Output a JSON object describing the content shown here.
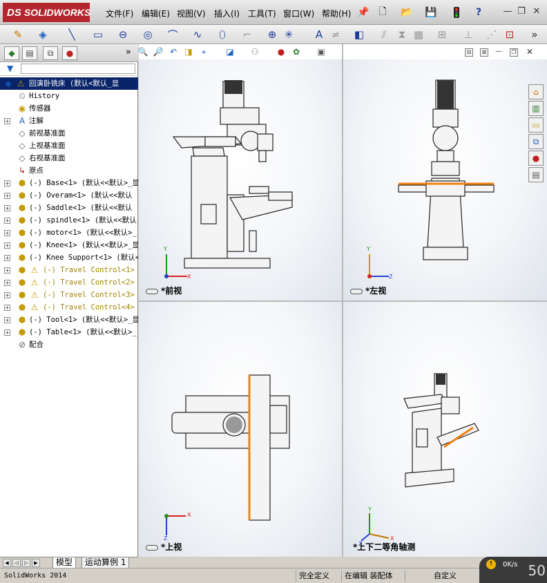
{
  "app": {
    "logo_text": "SOLIDWORKS",
    "logo_ds": "DS"
  },
  "menu": [
    "文件(F)",
    "编辑(E)",
    "视图(V)",
    "插入(I)",
    "工具(T)",
    "窗口(W)",
    "帮助(H)"
  ],
  "tabs": [
    "特征管理器",
    "属性管理器",
    "配置管理器",
    "外观管理器"
  ],
  "tree": {
    "root": "回演卧铣床 (默认<默认_显",
    "items": [
      {
        "label": "History",
        "icon": "history-icon",
        "indent": 1
      },
      {
        "label": "传感器",
        "icon": "sensor-icon",
        "indent": 1
      },
      {
        "label": "注解",
        "icon": "annotation-icon",
        "indent": 1,
        "expand": true
      },
      {
        "label": "前视基准面",
        "icon": "plane-icon",
        "indent": 1
      },
      {
        "label": "上视基准面",
        "icon": "plane-icon",
        "indent": 1
      },
      {
        "label": "右视基准面",
        "icon": "plane-icon",
        "indent": 1
      },
      {
        "label": "原点",
        "icon": "origin-icon",
        "indent": 1
      },
      {
        "label": "(-) Base<1> (默认<<默认>_显",
        "icon": "part-icon",
        "indent": 1,
        "expand": true
      },
      {
        "label": "(-) Overam<1> (默认<<默认",
        "icon": "part-icon",
        "indent": 1,
        "expand": true
      },
      {
        "label": "(-) Saddle<1> (默认<<默认",
        "icon": "part-icon",
        "indent": 1,
        "expand": true
      },
      {
        "label": "(-) spindle<1> (默认<<默认",
        "icon": "part-icon",
        "indent": 1,
        "expand": true
      },
      {
        "label": "(-) motor<1> (默认<<默认>_",
        "icon": "part-icon",
        "indent": 1,
        "expand": true
      },
      {
        "label": "(-) Knee<1> (默认<<默认>_显",
        "icon": "part-icon",
        "indent": 1,
        "expand": true
      },
      {
        "label": "(-) Knee Support<1> (默认<",
        "icon": "part-icon",
        "indent": 1,
        "expand": true
      },
      {
        "label": "(-) Travel Control<1> (",
        "icon": "part-icon",
        "indent": 1,
        "expand": true,
        "warn": true
      },
      {
        "label": "(-) Travel Control<2> (",
        "icon": "part-icon",
        "indent": 1,
        "expand": true,
        "warn": true
      },
      {
        "label": "(-) Travel Control<3> (",
        "icon": "part-icon",
        "indent": 1,
        "expand": true,
        "warn": true
      },
      {
        "label": "(-) Travel Control<4> (",
        "icon": "part-icon",
        "indent": 1,
        "expand": true,
        "warn": true
      },
      {
        "label": "(-) Tool<1> (默认<<默认>_显",
        "icon": "part-icon",
        "indent": 1,
        "expand": true
      },
      {
        "label": "(-) Table<1> (默认<<默认>_",
        "icon": "part-icon",
        "indent": 1,
        "expand": true
      },
      {
        "label": "配合",
        "icon": "mates-icon",
        "indent": 1
      }
    ]
  },
  "bottom_tabs": [
    "模型",
    "运动算例 1"
  ],
  "status": {
    "app_version": "SolidWorks 2014",
    "definition": "完全定义",
    "editing": "在编辑 装配体",
    "custom": "自定义"
  },
  "viewports": [
    {
      "label": "*前视",
      "axes": [
        "Y",
        "X"
      ]
    },
    {
      "label": "*左视",
      "axes": [
        "Y",
        "Z"
      ]
    },
    {
      "label": "*上视",
      "axes": [
        "X",
        "Z"
      ]
    },
    {
      "label": "*上下二等角轴测",
      "axes": [
        "Y",
        "X",
        "Z"
      ]
    }
  ],
  "network": {
    "speed": "0K/s",
    "percent": "50"
  },
  "colors": {
    "logo_red": "#b3262d",
    "axis_x": "#d62020",
    "axis_y": "#1a9a1a",
    "axis_z": "#1f3fd6",
    "highlight_orange": "#f07f12",
    "selection_blue": "#0a246a"
  }
}
